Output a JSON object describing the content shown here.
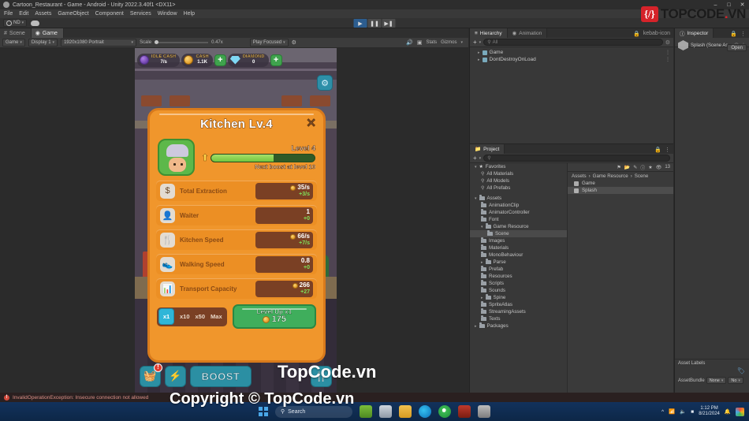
{
  "window": {
    "title": "Cartoon_Restaurant - Game - Android - Unity 2022.3.40f1 <DX11>",
    "minimize": "–",
    "maximize": "□",
    "close": "✕",
    "logo_icon": "unity-icon"
  },
  "menu": {
    "items": [
      "File",
      "Edit",
      "Assets",
      "GameObject",
      "Component",
      "Services",
      "Window",
      "Help"
    ]
  },
  "toolbar": {
    "account_label": "ND",
    "account_icon": "account-icon",
    "cloud_icon": "cloud-icon",
    "caret": "▾",
    "play": "▶",
    "pause": "❚❚",
    "step": "▶❚"
  },
  "game_panel": {
    "tabs": [
      {
        "label": "Scene",
        "icon": "scene-icon",
        "active": false
      },
      {
        "label": "Game",
        "icon": "game-icon",
        "active": true
      }
    ],
    "controls": {
      "target": "Game",
      "display": "Display 1",
      "resolution": "1920x1080 Portrait",
      "scale_label": "Scale",
      "scale_value": "0.47x",
      "play_mode": "Play Focused",
      "mute_icon": "mute-icon",
      "stats": "Stats",
      "gizmos": "Gizmos",
      "settings_icon": "gear-icon",
      "caret": "▾"
    }
  },
  "game": {
    "hud_top": [
      {
        "name": "idle-cash",
        "icon": "idle-cash-icon",
        "title": "IDLE CASH",
        "value": "7/s",
        "plus": false
      },
      {
        "name": "cash",
        "icon": "coin-icon",
        "title": "CASH",
        "value": "1.1K",
        "plus": true
      },
      {
        "name": "diamond",
        "icon": "diamond-icon",
        "title": "DIAMOND",
        "value": "0",
        "plus": true
      }
    ],
    "plus_label": "+",
    "settings_icon": "gear-icon",
    "hud_bottom": [
      {
        "name": "inventory-button",
        "icon": "basket-icon",
        "glyph": "🧺",
        "badge": "!"
      },
      {
        "name": "energy-button",
        "icon": "lightning-icon",
        "glyph": "⚡",
        "badge": ""
      },
      {
        "name": "boost-button",
        "icon": "boost-icon",
        "label": "BOOST",
        "badge": ""
      },
      {
        "name": "menu-button",
        "icon": "cutlery-icon",
        "glyph": "🍴",
        "badge": ""
      }
    ]
  },
  "dialog": {
    "title": "Kitchen Lv.4",
    "close": "✕",
    "avatar_icon": "chef-avatar-icon",
    "level_label": "Level 4",
    "progress_pct": 60,
    "next_boost": "Next boost at level 10",
    "arrow_icon": "up-arrow-icon",
    "stats": [
      {
        "icon": "dollar-icon",
        "glyph": "$",
        "name": "Total Extraction",
        "value": "35/s",
        "delta": "+3/s",
        "coin": true
      },
      {
        "icon": "waiter-icon",
        "glyph": "👤",
        "name": "Waiter",
        "value": "1",
        "delta": "+0",
        "coin": false
      },
      {
        "icon": "utensils-icon",
        "glyph": "🍴",
        "name": "Kitchen Speed",
        "value": "66/s",
        "delta": "+7/s",
        "coin": true
      },
      {
        "icon": "shoe-icon",
        "glyph": "👟",
        "name": "Walking Speed",
        "value": "0.8",
        "delta": "+0",
        "coin": false
      },
      {
        "icon": "bars-icon",
        "glyph": "📊",
        "name": "Transport Capacity",
        "value": "266",
        "delta": "+27",
        "coin": true
      }
    ],
    "multipliers": [
      {
        "label": "x1",
        "selected": true
      },
      {
        "label": "x10",
        "selected": false
      },
      {
        "label": "x50",
        "selected": false
      },
      {
        "label": "Max",
        "selected": false
      }
    ],
    "levelup_label": "Level Up x1",
    "levelup_cost": "175"
  },
  "hierarchy": {
    "tabs": [
      {
        "label": "Hierarchy",
        "icon": "hierarchy-icon",
        "active": true
      },
      {
        "label": "Animation",
        "icon": "animation-icon",
        "active": false
      }
    ],
    "add_label": "+",
    "search_placeholder": "All",
    "search_icon": "search-icon",
    "lock_icon": "lock-icon",
    "menu_icon": "kebab-icon",
    "items": [
      {
        "label": "Game",
        "arrow": "▸"
      },
      {
        "label": "DontDestroyOnLoad",
        "arrow": "▸"
      }
    ]
  },
  "project": {
    "tab": "Project",
    "tab_icon": "project-icon",
    "add_label": "+",
    "search_icon": "search-icon",
    "tree": [
      {
        "label": "Favorites",
        "indent": 0,
        "icon": "star-icon",
        "arrow": "▾",
        "selected": false
      },
      {
        "label": "All Materials",
        "indent": 1,
        "icon": "search-icon",
        "arrow": "",
        "selected": false
      },
      {
        "label": "All Models",
        "indent": 1,
        "icon": "search-icon",
        "arrow": "",
        "selected": false
      },
      {
        "label": "All Prefabs",
        "indent": 1,
        "icon": "search-icon",
        "arrow": "",
        "selected": false
      },
      {
        "label": "Assets",
        "indent": 0,
        "icon": "folder-icon",
        "arrow": "▾",
        "selected": false
      },
      {
        "label": "AnimationClip",
        "indent": 1,
        "icon": "folder-icon",
        "arrow": "",
        "selected": false
      },
      {
        "label": "AnimatorController",
        "indent": 1,
        "icon": "folder-icon",
        "arrow": "",
        "selected": false
      },
      {
        "label": "Font",
        "indent": 1,
        "icon": "folder-icon",
        "arrow": "",
        "selected": false
      },
      {
        "label": "Game Resource",
        "indent": 1,
        "icon": "folder-icon",
        "arrow": "▾",
        "selected": false
      },
      {
        "label": "Scene",
        "indent": 2,
        "icon": "folder-icon",
        "arrow": "",
        "selected": true
      },
      {
        "label": "Images",
        "indent": 1,
        "icon": "folder-icon",
        "arrow": "",
        "selected": false
      },
      {
        "label": "Materials",
        "indent": 1,
        "icon": "folder-icon",
        "arrow": "",
        "selected": false
      },
      {
        "label": "MonoBehaviour",
        "indent": 1,
        "icon": "folder-icon",
        "arrow": "",
        "selected": false
      },
      {
        "label": "Parse",
        "indent": 1,
        "icon": "folder-icon",
        "arrow": "▸",
        "selected": false
      },
      {
        "label": "Prefab",
        "indent": 1,
        "icon": "folder-icon",
        "arrow": "",
        "selected": false
      },
      {
        "label": "Resources",
        "indent": 1,
        "icon": "folder-icon",
        "arrow": "",
        "selected": false
      },
      {
        "label": "Scripts",
        "indent": 1,
        "icon": "folder-icon",
        "arrow": "",
        "selected": false
      },
      {
        "label": "Sounds",
        "indent": 1,
        "icon": "folder-icon",
        "arrow": "",
        "selected": false
      },
      {
        "label": "Spine",
        "indent": 1,
        "icon": "folder-icon",
        "arrow": "▸",
        "selected": false
      },
      {
        "label": "SpriteAtlas",
        "indent": 1,
        "icon": "folder-icon",
        "arrow": "",
        "selected": false
      },
      {
        "label": "StreamingAssets",
        "indent": 1,
        "icon": "folder-icon",
        "arrow": "",
        "selected": false
      },
      {
        "label": "Texts",
        "indent": 1,
        "icon": "folder-icon",
        "arrow": "",
        "selected": false
      },
      {
        "label": "Packages",
        "indent": 0,
        "icon": "folder-icon",
        "arrow": "▸",
        "selected": false
      }
    ],
    "breadcrumb": [
      "Assets",
      "Game Resource",
      "Scene"
    ],
    "breadcrumb_sep": "›",
    "assets": [
      {
        "label": "Game",
        "icon": "unity-scene-icon",
        "selected": false
      },
      {
        "label": "Splash",
        "icon": "unity-scene-icon",
        "selected": true
      }
    ],
    "zoom_count": "13",
    "status_path": "Assets/Game Resource/Scene/",
    "toolbar_icons": [
      "save-search-icon",
      "new-folder-icon",
      "pick-icon",
      "help-icon",
      "favorite-icon",
      "visibility-icon"
    ]
  },
  "inspector": {
    "tab": "Inspector",
    "tab_icon": "info-icon",
    "lock_icon": "lock-icon",
    "menu_icon": "kebab-icon",
    "asset_name": "Splash (Scene As",
    "help_icon": "help-icon",
    "open_button": "Open",
    "asset_labels_title": "Asset Labels",
    "label_icon": "tag-icon",
    "bundle_label": "AssetBundle",
    "bundle_value": "None",
    "bundle_value2": "No",
    "caret": "▾",
    "footer_icons": [
      "debug-icon",
      "grid-icon",
      "light-icon",
      "check-icon"
    ]
  },
  "status": {
    "error_badge": "!",
    "error_text": "InvalidOperationException: Insecure connection not allowed"
  },
  "taskbar": {
    "start_icon": "windows-icon",
    "search_placeholder": "Search",
    "search_icon": "search-icon",
    "apps": [
      "taskview-icon",
      "file-explorer-icon",
      "edge-icon",
      "chrome-icon",
      "app-red-icon",
      "unity-icon"
    ],
    "tray_icons": [
      "chevron-up-icon",
      "wifi-icon",
      "volume-icon",
      "battery-icon"
    ],
    "notification_icon": "bell-icon",
    "time": "1:12 PM",
    "date": "8/21/2024"
  },
  "watermark": {
    "logo_glyph": "{/}",
    "brand_top": "TOPCODE",
    "brand_dot": ".",
    "brand_tld": "VN",
    "center": "TopCode.vn",
    "bottom": "Copyright © TopCode.vn"
  },
  "colors": {
    "accent_orange": "#f0962c",
    "accent_green": "#3fae5c",
    "accent_blue": "#2fb6d8",
    "brand_red": "#d6232a",
    "error": "#d34a3c"
  }
}
